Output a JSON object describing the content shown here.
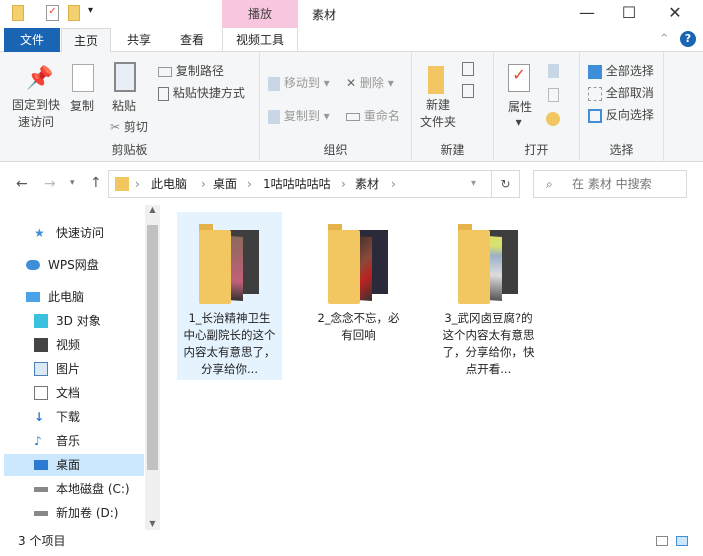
{
  "window": {
    "title": "素材",
    "context_tab": "播放",
    "minimize": "—",
    "maximize": "☐",
    "close": "✕"
  },
  "tabs": [
    {
      "label": "文件"
    },
    {
      "label": "主页"
    },
    {
      "label": "共享"
    },
    {
      "label": "查看"
    },
    {
      "label": "视频工具"
    }
  ],
  "help": "?",
  "ribbon": {
    "clipboard": {
      "label": "剪贴板",
      "pin": "固定到快",
      "pin2": "速访问",
      "copy": "复制",
      "paste": "粘贴",
      "copy_path": "复制路径",
      "paste_shortcut": "粘贴快捷方式",
      "cut": "剪切"
    },
    "organize": {
      "label": "组织",
      "move_to": "移动到",
      "copy_to": "复制到",
      "delete": "删除",
      "rename": "重命名"
    },
    "new": {
      "label": "新建",
      "new_folder": "新建",
      "new_folder2": "文件夹"
    },
    "open": {
      "label": "打开",
      "properties": "属性"
    },
    "select": {
      "label": "选择",
      "select_all": "全部选择",
      "select_none": "全部取消",
      "invert": "反向选择"
    }
  },
  "address": {
    "crumbs": [
      "此电脑",
      "桌面",
      "1咕咕咕咕咕",
      "素材"
    ],
    "search_placeholder": "在 素材 中搜索"
  },
  "sidebar": [
    {
      "label": "快速访问"
    },
    {
      "label": "WPS网盘"
    },
    {
      "label": "此电脑"
    },
    {
      "label": "3D 对象"
    },
    {
      "label": "视频"
    },
    {
      "label": "图片"
    },
    {
      "label": "文档"
    },
    {
      "label": "下载"
    },
    {
      "label": "音乐"
    },
    {
      "label": "桌面"
    },
    {
      "label": "本地磁盘 (C:)"
    },
    {
      "label": "新加卷 (D:)"
    }
  ],
  "files": [
    {
      "name": "1_长治精神卫生中心副院长的这个内容太有意思了，分享给你..."
    },
    {
      "name": "2_念念不忘，必有回响"
    },
    {
      "name": "3_武冈卤豆腐?的这个内容太有意思了，分享给你，快点开看..."
    }
  ],
  "status": {
    "count": "3 个项目"
  },
  "colors": {
    "accent": "#1a64b4",
    "selected": "#cce8ff",
    "context": "#f8c6de"
  }
}
